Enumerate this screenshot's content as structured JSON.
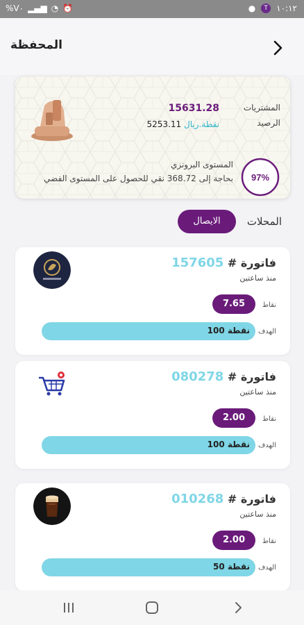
{
  "status_bar": {
    "battery": "%V٠",
    "time": "١٠:١٢",
    "badge": "T"
  },
  "header": {
    "title": "المحفظة"
  },
  "summary": {
    "purchases_label": "المشتريات",
    "purchases_value": "15631.28",
    "balance_label": "الرصيد",
    "balance_value": "5253.11",
    "balance_unit": "نقطة.ريال",
    "progress_text": "97%",
    "progress_fraction": 0.97,
    "level_label": "المستوى البرونزي",
    "level_hint_prefix": "بحاجة إلى",
    "level_hint_amount": "368.72",
    "level_hint_suffix": "نقي للحصول على المستوى الفضي"
  },
  "tabs": {
    "stores": "المحلات",
    "receipts": "الايصال"
  },
  "invoices": [
    {
      "title": "فاتورة #",
      "number": "157605",
      "time": "منذ ساعتين",
      "points_label": "نقاط",
      "points": "7.65",
      "target_label": "الهدف",
      "target_value": "100",
      "target_unit": "نقطة",
      "progress": 1.0,
      "logo": "BESTA logo"
    },
    {
      "title": "فاتورة #",
      "number": "080278",
      "time": "منذ ساعتين",
      "points_label": "نقاط",
      "points": "2.00",
      "target_label": "الهدف",
      "target_value": "100",
      "target_unit": "نقطة",
      "progress": 1.0,
      "logo": "shopping-cart-logo"
    },
    {
      "title": "فاتورة #",
      "number": "010268",
      "time": "منذ ساعتين",
      "points_label": "نقاط",
      "points": "2.00",
      "target_label": "الهدف",
      "target_value": "50",
      "target_unit": "نقطة",
      "progress": 1.0,
      "logo": "drink-glass-logo"
    }
  ],
  "nav": {
    "recent": "recents-icon",
    "home": "home-icon",
    "back": "back-icon"
  },
  "colors": {
    "primary": "#6a1b7a",
    "accent": "#7fd6e6"
  }
}
